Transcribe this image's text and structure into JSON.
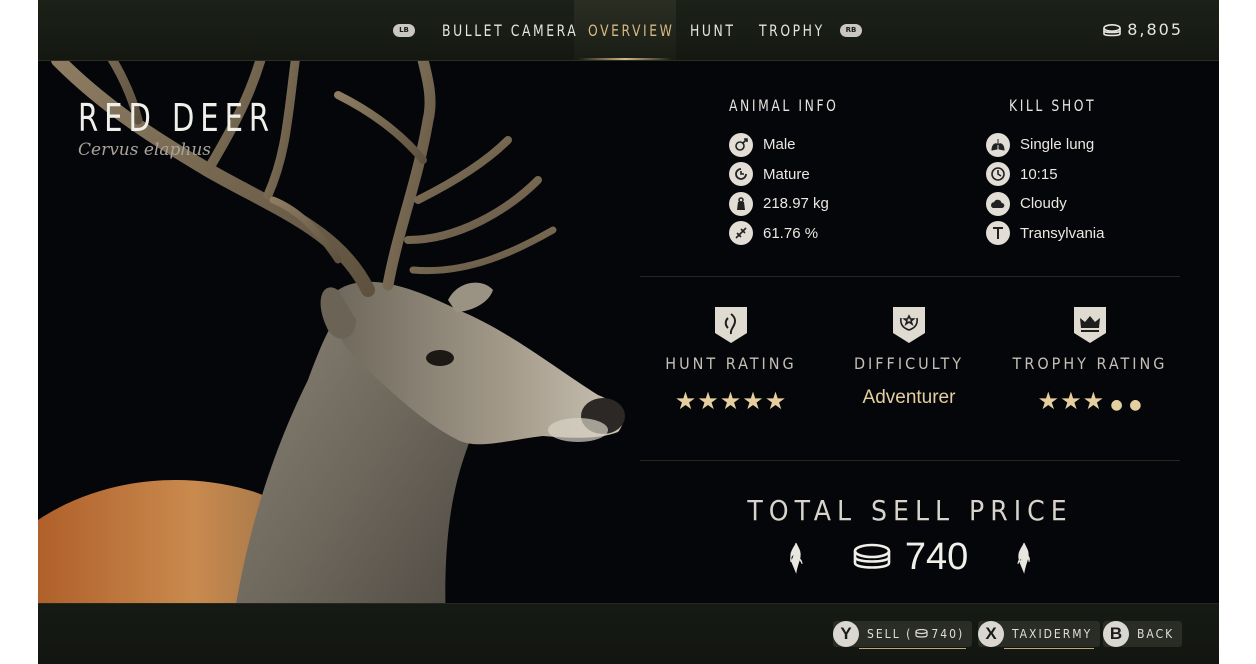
{
  "top_bar": {
    "lb": "LB",
    "rb": "RB",
    "tabs": [
      {
        "label": "BULLET CAMERA"
      },
      {
        "label": "OVERVIEW"
      },
      {
        "label": "HUNT"
      },
      {
        "label": "TROPHY"
      }
    ],
    "active_tab": "OVERVIEW",
    "money": "8,805"
  },
  "animal": {
    "name": "RED DEER",
    "latin": "Cervus elaphus"
  },
  "animal_info": {
    "title": "ANIMAL INFO",
    "items": [
      {
        "icon": "gender-icon",
        "text": "Male"
      },
      {
        "icon": "age-icon",
        "text": "Mature"
      },
      {
        "icon": "weight-icon",
        "text": "218.97 kg"
      },
      {
        "icon": "integrity-icon",
        "text": "61.76 %"
      }
    ]
  },
  "kill_shot": {
    "title": "KILL SHOT",
    "items": [
      {
        "icon": "lung-icon",
        "text": "Single lung"
      },
      {
        "icon": "clock-icon",
        "text": "10:15"
      },
      {
        "icon": "weather-icon",
        "text": "Cloudy"
      },
      {
        "icon": "location-icon",
        "text": "Transylvania"
      }
    ]
  },
  "ratings": {
    "hunt": {
      "label": "HUNT RATING",
      "stars": 5,
      "max": 5
    },
    "difficulty": {
      "label": "DIFFICULTY",
      "value": "Adventurer"
    },
    "trophy": {
      "label": "TROPHY RATING",
      "stars": 3,
      "max": 5
    }
  },
  "total": {
    "label": "TOTAL SELL PRICE",
    "value": "740"
  },
  "prompts": {
    "sell": {
      "button": "Y",
      "label_prefix": "SELL (",
      "amount": "740",
      "label_suffix": ")"
    },
    "taxidermy": {
      "button": "X",
      "label": "TAXIDERMY"
    },
    "back": {
      "button": "B",
      "label": "BACK"
    }
  },
  "colors": {
    "accent": "#d7b882",
    "star": "#e6cf9e",
    "background": "#05060a"
  }
}
